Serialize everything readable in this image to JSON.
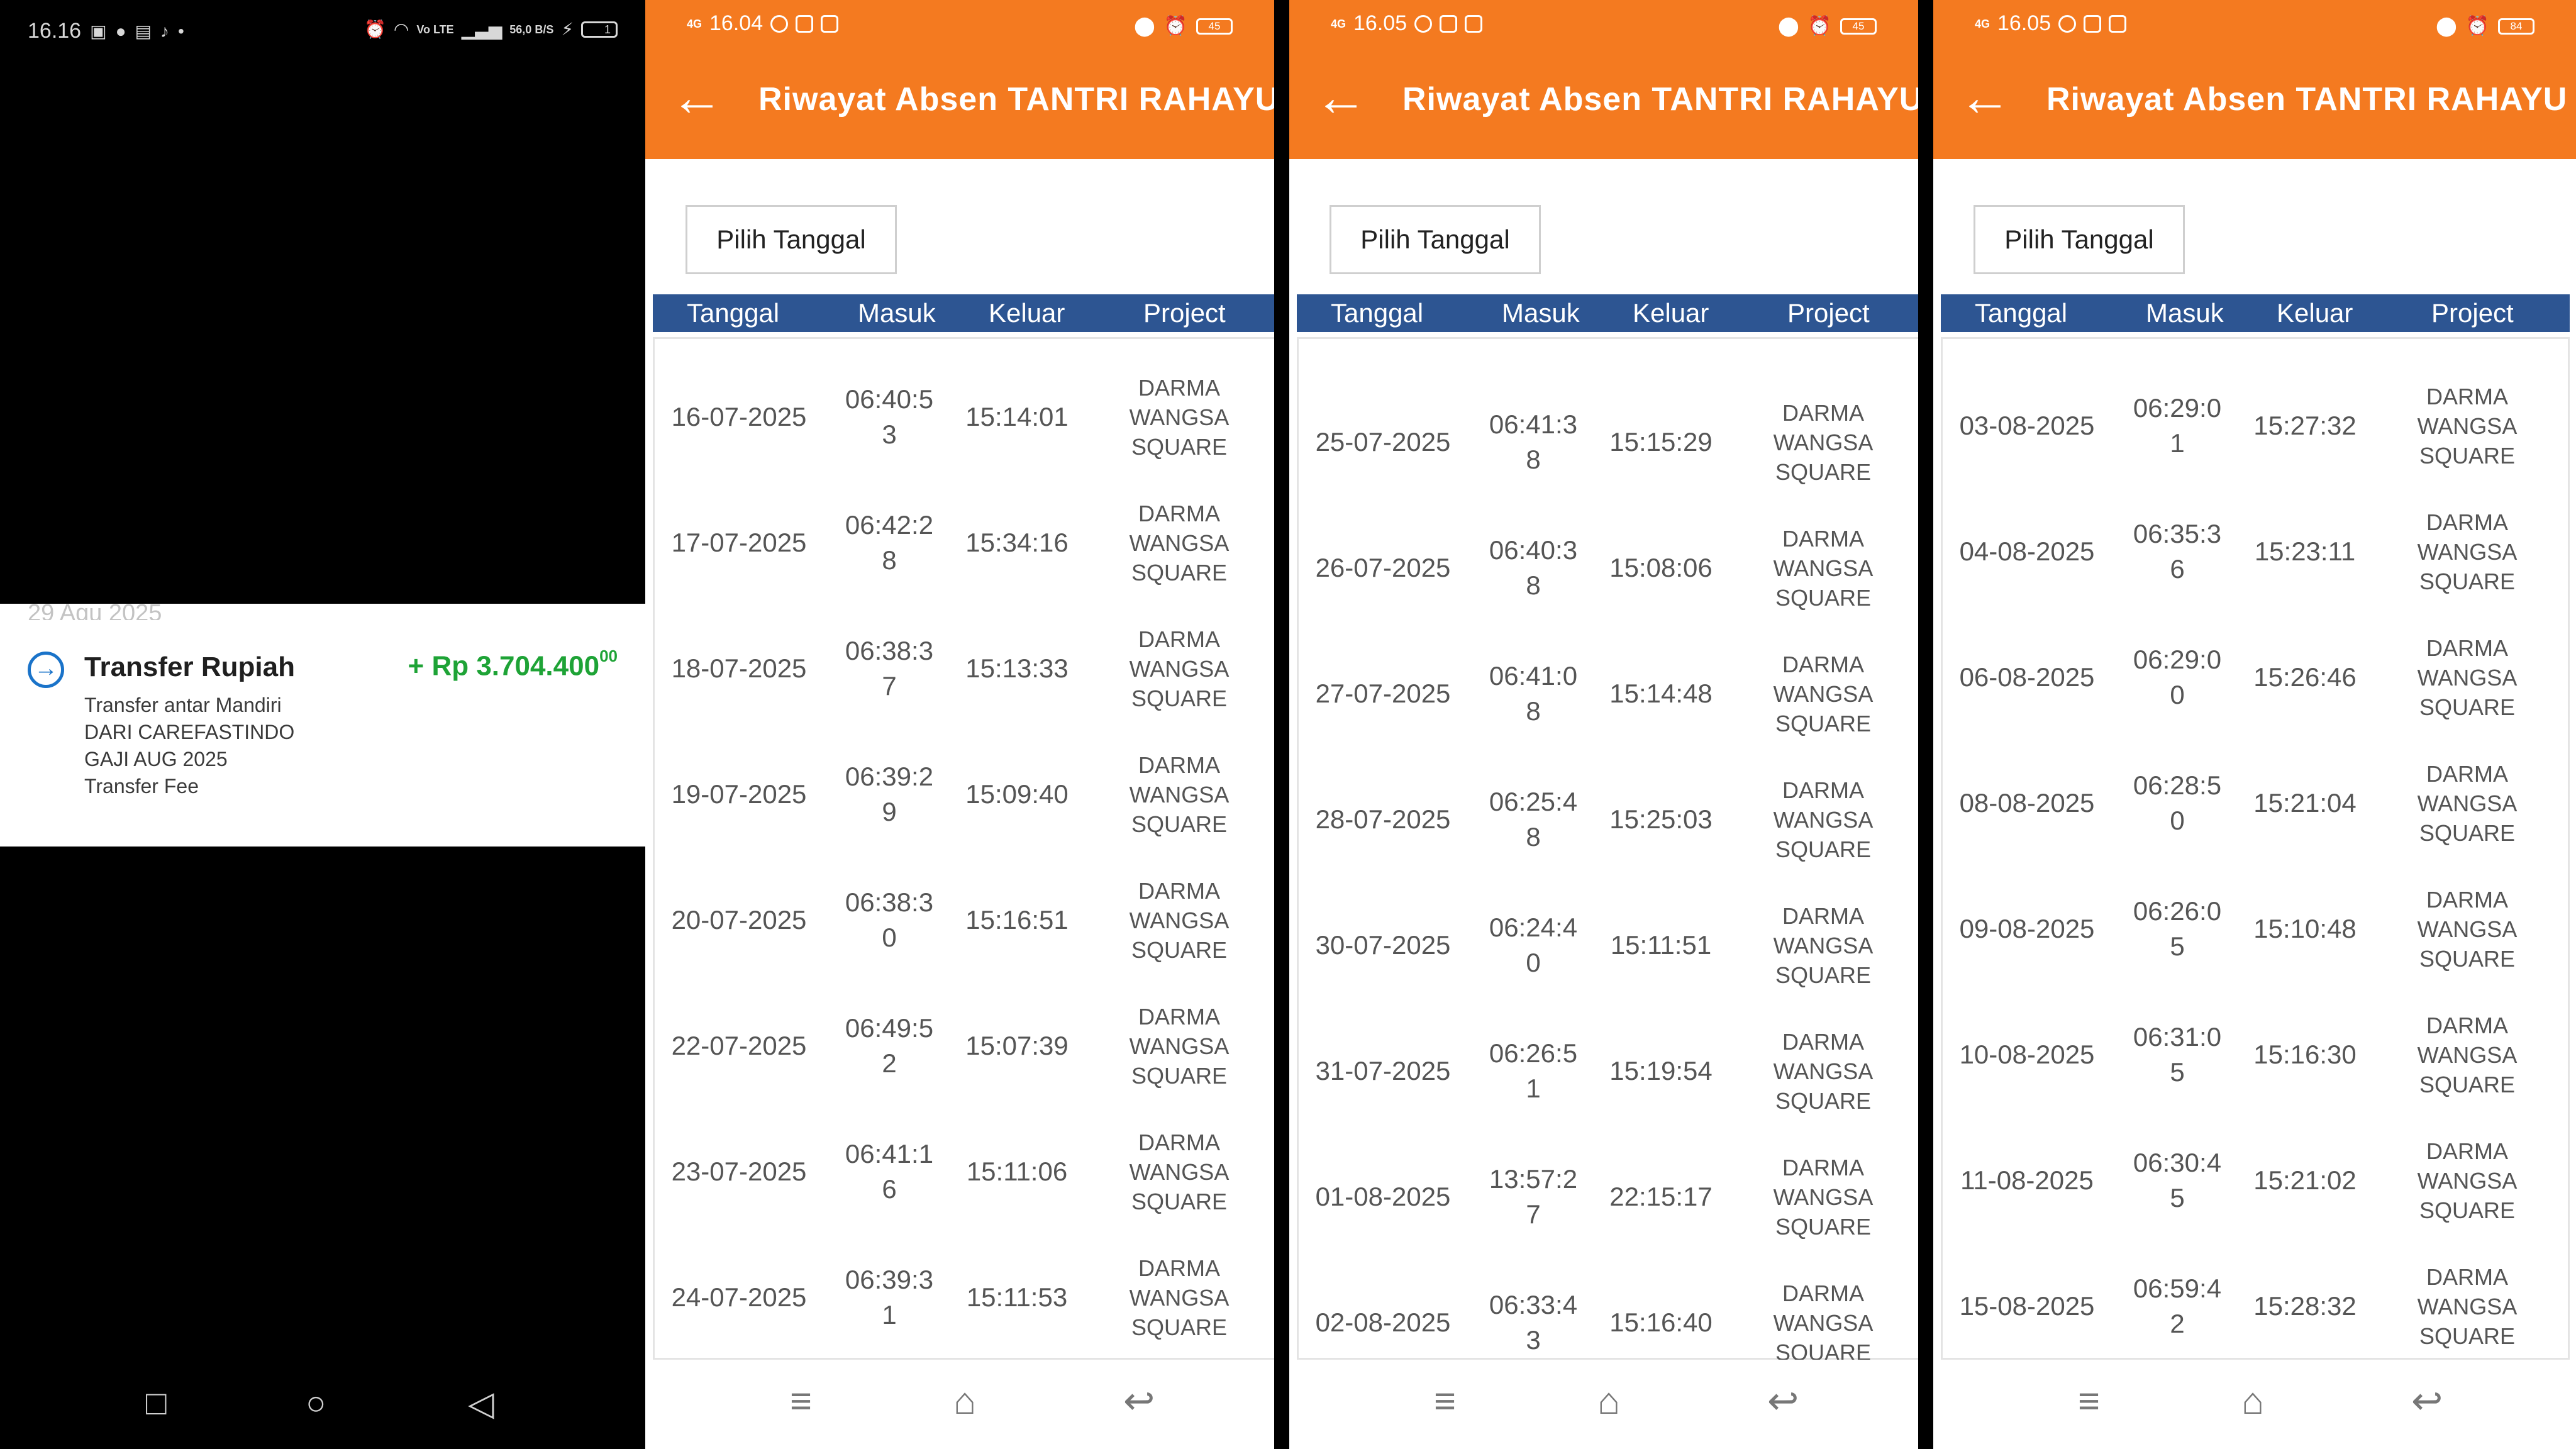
{
  "bank": {
    "status_time": "16.16",
    "status_net": "56,0 B/S",
    "status_lte": "Vo LTE",
    "battery": "1",
    "date_peek": "29 Agu 2025",
    "title": "Transfer Rupiah",
    "amount": "+ Rp 3.704.400",
    "amount_cents": "00",
    "desc1": "Transfer antar Mandiri",
    "desc2": "DARI CAREFASTINDO",
    "desc3": "GAJI AUG 2025",
    "desc4": "Transfer Fee"
  },
  "common": {
    "title": "Riwayat Absen TANTRI RAHAYU",
    "pick": "Pilih Tanggal",
    "h_tanggal": "Tanggal",
    "h_masuk": "Masuk",
    "h_keluar": "Keluar",
    "h_project": "Project",
    "net": "4G"
  },
  "panels": [
    {
      "time": "16.04",
      "battery": "45",
      "rows": [
        {
          "tanggal": "16-07-2025",
          "masuk": "06:40:53",
          "keluar": "15:14:01",
          "project": "DARMA WANGSA SQUARE"
        },
        {
          "tanggal": "17-07-2025",
          "masuk": "06:42:28",
          "keluar": "15:34:16",
          "project": "DARMA WANGSA SQUARE"
        },
        {
          "tanggal": "18-07-2025",
          "masuk": "06:38:37",
          "keluar": "15:13:33",
          "project": "DARMA WANGSA SQUARE"
        },
        {
          "tanggal": "19-07-2025",
          "masuk": "06:39:29",
          "keluar": "15:09:40",
          "project": "DARMA WANGSA SQUARE"
        },
        {
          "tanggal": "20-07-2025",
          "masuk": "06:38:30",
          "keluar": "15:16:51",
          "project": "DARMA WANGSA SQUARE"
        },
        {
          "tanggal": "22-07-2025",
          "masuk": "06:49:52",
          "keluar": "15:07:39",
          "project": "DARMA WANGSA SQUARE"
        },
        {
          "tanggal": "23-07-2025",
          "masuk": "06:41:16",
          "keluar": "15:11:06",
          "project": "DARMA WANGSA SQUARE"
        },
        {
          "tanggal": "24-07-2025",
          "masuk": "06:39:31",
          "keluar": "15:11:53",
          "project": "DARMA WANGSA SQUARE"
        }
      ]
    },
    {
      "time": "16.05",
      "battery": "45",
      "rows": [
        {
          "tanggal": "25-07-2025",
          "masuk": "06:41:38",
          "keluar": "15:15:29",
          "project": "DARMA WANGSA SQUARE"
        },
        {
          "tanggal": "26-07-2025",
          "masuk": "06:40:38",
          "keluar": "15:08:06",
          "project": "DARMA WANGSA SQUARE"
        },
        {
          "tanggal": "27-07-2025",
          "masuk": "06:41:08",
          "keluar": "15:14:48",
          "project": "DARMA WANGSA SQUARE"
        },
        {
          "tanggal": "28-07-2025",
          "masuk": "06:25:48",
          "keluar": "15:25:03",
          "project": "DARMA WANGSA SQUARE"
        },
        {
          "tanggal": "30-07-2025",
          "masuk": "06:24:40",
          "keluar": "15:11:51",
          "project": "DARMA WANGSA SQUARE"
        },
        {
          "tanggal": "31-07-2025",
          "masuk": "06:26:51",
          "keluar": "15:19:54",
          "project": "DARMA WANGSA SQUARE"
        },
        {
          "tanggal": "01-08-2025",
          "masuk": "13:57:27",
          "keluar": "22:15:17",
          "project": "DARMA WANGSA SQUARE"
        },
        {
          "tanggal": "02-08-2025",
          "masuk": "06:33:43",
          "keluar": "15:16:40",
          "project": "DARMA WANGSA SQUARE"
        }
      ]
    },
    {
      "time": "16.05",
      "battery": "84",
      "rows": [
        {
          "tanggal": "03-08-2025",
          "masuk": "06:29:01",
          "keluar": "15:27:32",
          "project": "DARMA WANGSA SQUARE"
        },
        {
          "tanggal": "04-08-2025",
          "masuk": "06:35:36",
          "keluar": "15:23:11",
          "project": "DARMA WANGSA SQUARE"
        },
        {
          "tanggal": "06-08-2025",
          "masuk": "06:29:00",
          "keluar": "15:26:46",
          "project": "DARMA WANGSA SQUARE"
        },
        {
          "tanggal": "08-08-2025",
          "masuk": "06:28:50",
          "keluar": "15:21:04",
          "project": "DARMA WANGSA SQUARE"
        },
        {
          "tanggal": "09-08-2025",
          "masuk": "06:26:05",
          "keluar": "15:10:48",
          "project": "DARMA WANGSA SQUARE"
        },
        {
          "tanggal": "10-08-2025",
          "masuk": "06:31:05",
          "keluar": "15:16:30",
          "project": "DARMA WANGSA SQUARE"
        },
        {
          "tanggal": "11-08-2025",
          "masuk": "06:30:45",
          "keluar": "15:21:02",
          "project": "DARMA WANGSA SQUARE"
        },
        {
          "tanggal": "15-08-2025",
          "masuk": "06:59:42",
          "keluar": "15:28:32",
          "project": "DARMA WANGSA SQUARE"
        }
      ]
    }
  ]
}
